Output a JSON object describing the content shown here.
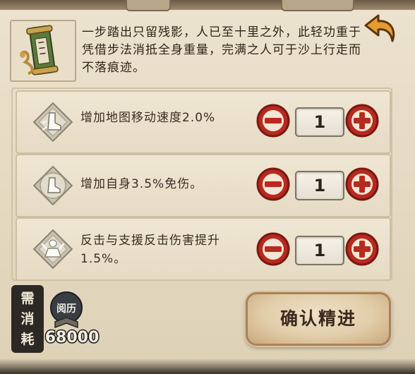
{
  "description": {
    "text": "一步踏出只留残影，人已至十里之外，此轻功重于凭借步法消抵全身重量，完满之人可于沙上行走而不落痕迹。",
    "icon": "scroll-icon"
  },
  "back_icon": "back-arrow-icon",
  "rows": [
    {
      "label": "增加地图移动速度2.0%",
      "value": "1",
      "icon": "boot-speed-icon"
    },
    {
      "label": "增加自身3.5%免伤。",
      "value": "1",
      "icon": "boot-defense-icon"
    },
    {
      "label": "反击与支援反击伤害提升1.5%。",
      "value": "1",
      "icon": "figure-counter-icon"
    }
  ],
  "cost": {
    "label": [
      "需",
      "消",
      "耗"
    ],
    "currency_icon": "experience-book-icon",
    "currency_icon_text": "阅历",
    "amount": "68000"
  },
  "confirm_label": "确认精进",
  "colors": {
    "accent_red": "#b8291f",
    "panel": "#e7dcc6",
    "button": "#e1cda9"
  }
}
